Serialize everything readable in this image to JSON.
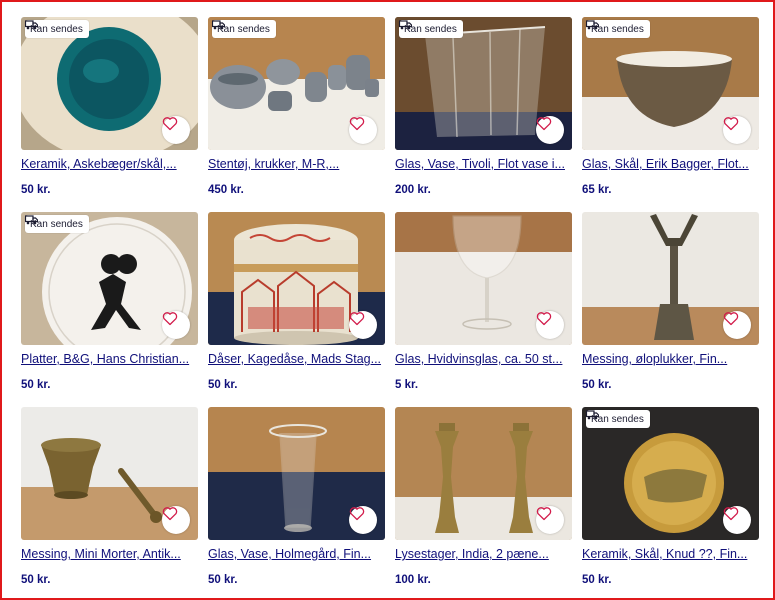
{
  "shipping_badge": "Kan sendes",
  "listings": [
    {
      "title": "Keramik, Askebæger/skål,...",
      "price": "50 kr.",
      "shippable": true
    },
    {
      "title": "Stentøj, krukker, M-R,...",
      "price": "450 kr.",
      "shippable": true
    },
    {
      "title": "Glas, Vase, Tivoli, Flot vase i...",
      "price": "200 kr.",
      "shippable": true
    },
    {
      "title": "Glas, Skål, Erik Bagger, Flot...",
      "price": "65 kr.",
      "shippable": true
    },
    {
      "title": "Platter, B&G, Hans Christian...",
      "price": "50 kr.",
      "shippable": true
    },
    {
      "title": "Dåser, Kagedåse, Mads Stag...",
      "price": "50 kr.",
      "shippable": false
    },
    {
      "title": "Glas, Hvidvinsglas, ca. 50 st...",
      "price": "5 kr.",
      "shippable": false
    },
    {
      "title": "Messing, øloplukker, Fin...",
      "price": "50 kr.",
      "shippable": false
    },
    {
      "title": "Messing, Mini Morter, Antik...",
      "price": "50 kr.",
      "shippable": false
    },
    {
      "title": "Glas, Vase, Holmegård, Fin...",
      "price": "50 kr.",
      "shippable": false
    },
    {
      "title": "Lysestager, India, 2 pæne...",
      "price": "100 kr.",
      "shippable": false
    },
    {
      "title": "Keramik, Skål, Knud ??, Fin...",
      "price": "50 kr.",
      "shippable": true
    }
  ],
  "colors": {
    "frame": "#e0191b",
    "link": "#10107a",
    "heart": "#d21c4b"
  }
}
